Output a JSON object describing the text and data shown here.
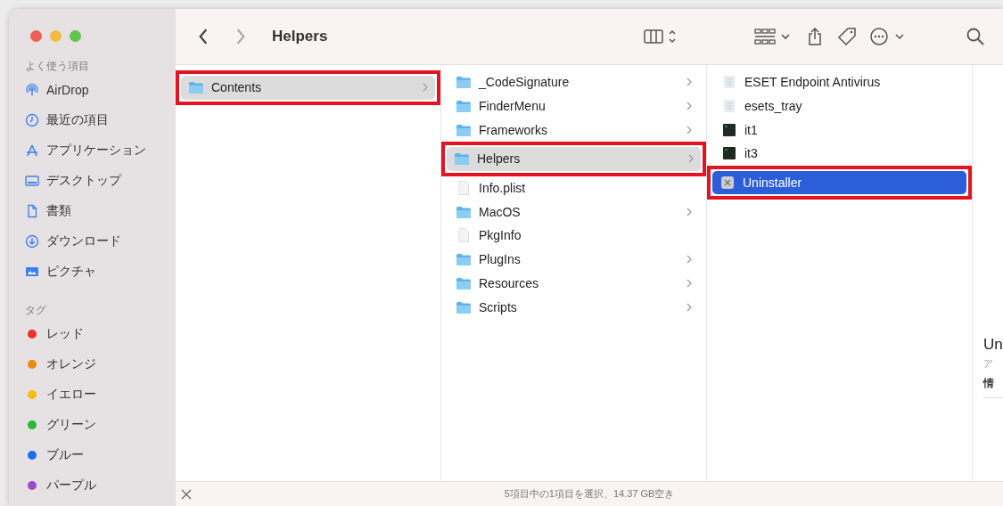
{
  "window": {
    "title": "Helpers"
  },
  "sidebar": {
    "sections": [
      {
        "heading": "よく使う項目",
        "items": [
          {
            "label": "AirDrop",
            "kind": "airdrop"
          },
          {
            "label": "最近の項目",
            "kind": "recent"
          },
          {
            "label": "アプリケーション",
            "kind": "apps"
          },
          {
            "label": "デスクトップ",
            "kind": "desktop"
          },
          {
            "label": "書類",
            "kind": "document"
          },
          {
            "label": "ダウンロード",
            "kind": "download"
          },
          {
            "label": "ピクチャ",
            "kind": "pictures"
          }
        ]
      },
      {
        "heading": "タグ",
        "items": [
          {
            "label": "レッド",
            "kind": "tag",
            "color": "#f0302e"
          },
          {
            "label": "オレンジ",
            "kind": "tag",
            "color": "#f08a10"
          },
          {
            "label": "イエロー",
            "kind": "tag",
            "color": "#f2be0a"
          },
          {
            "label": "グリーン",
            "kind": "tag",
            "color": "#28b83a"
          },
          {
            "label": "ブルー",
            "kind": "tag",
            "color": "#1a6ff0"
          },
          {
            "label": "パープル",
            "kind": "tag",
            "color": "#a048d0"
          }
        ]
      }
    ]
  },
  "columns": [
    {
      "focused": false,
      "items": [
        {
          "name": "Contents",
          "kind": "folder",
          "selected": true,
          "annotated": true
        }
      ]
    },
    {
      "focused": false,
      "items": [
        {
          "name": "_CodeSignature",
          "kind": "folder",
          "selected": false,
          "annotated": false
        },
        {
          "name": "FinderMenu",
          "kind": "folder",
          "selected": false,
          "annotated": false
        },
        {
          "name": "Frameworks",
          "kind": "folder",
          "selected": false,
          "annotated": false
        },
        {
          "name": "Helpers",
          "kind": "folder",
          "selected": true,
          "annotated": true
        },
        {
          "name": "Info.plist",
          "kind": "file",
          "selected": false,
          "annotated": false
        },
        {
          "name": "MacOS",
          "kind": "folder",
          "selected": false,
          "annotated": false
        },
        {
          "name": "PkgInfo",
          "kind": "file",
          "selected": false,
          "annotated": false
        },
        {
          "name": "PlugIns",
          "kind": "folder",
          "selected": false,
          "annotated": false
        },
        {
          "name": "Resources",
          "kind": "folder",
          "selected": false,
          "annotated": false
        },
        {
          "name": "Scripts",
          "kind": "folder",
          "selected": false,
          "annotated": false
        }
      ]
    },
    {
      "focused": true,
      "items": [
        {
          "name": "ESET Endpoint Antivirus",
          "kind": "bundle",
          "selected": false,
          "annotated": false
        },
        {
          "name": "esets_tray",
          "kind": "bundle",
          "selected": false,
          "annotated": false
        },
        {
          "name": "it1",
          "kind": "executable",
          "selected": false,
          "annotated": false
        },
        {
          "name": "it3",
          "kind": "executable",
          "selected": false,
          "annotated": false
        },
        {
          "name": "Uninstaller",
          "kind": "app",
          "selected": true,
          "annotated": true
        }
      ]
    }
  ],
  "preview": {
    "title": "Un",
    "subtitle": "ア",
    "section": "情"
  },
  "status_bar": {
    "text": "5項目中の1項目を選択、14.37 GB空き"
  }
}
